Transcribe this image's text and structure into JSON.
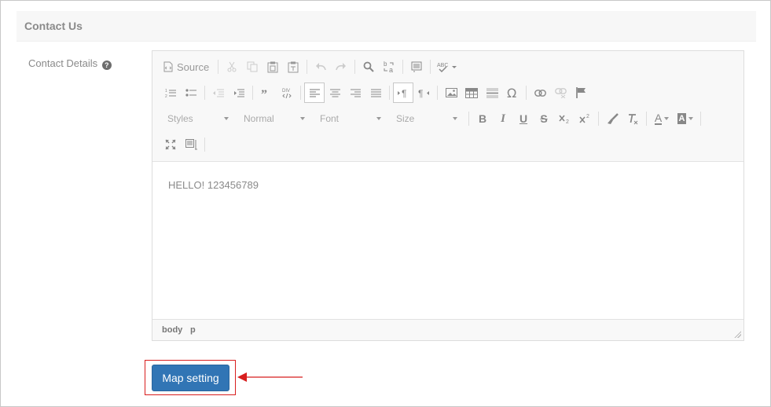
{
  "section": {
    "title": "Contact Us"
  },
  "field": {
    "label": "Contact Details",
    "help_icon": "question-circle-icon"
  },
  "editor": {
    "toolbar": {
      "source_label": "Source",
      "styles_label": "Styles",
      "format_label": "Normal",
      "font_label": "Font",
      "size_label": "Size",
      "bold_label": "B",
      "italic_label": "I",
      "underline_label": "U",
      "strike_label": "S",
      "text_color_label": "A",
      "bg_color_label": "A"
    },
    "content": "HELLO! 123456789",
    "path": [
      "body",
      "p"
    ]
  },
  "map_button": {
    "label": "Map setting"
  },
  "colors": {
    "primary_button": "#3175b5",
    "highlight_border": "#d81e1e",
    "arrow": "#d81e1e"
  }
}
